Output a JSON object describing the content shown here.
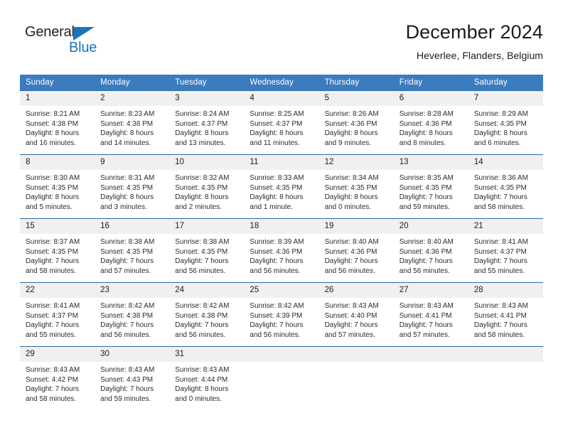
{
  "brand": {
    "name_dark": "General",
    "name_blue": "Blue",
    "accent_color": "#1a74bb",
    "triangle_icon": "triangle-icon"
  },
  "header": {
    "title": "December 2024",
    "subtitle": "Heverlee, Flanders, Belgium"
  },
  "theme": {
    "header_blue": "#3a7cbf",
    "row_rule": "#2e6da4",
    "daynum_band": "#f0f0f0"
  },
  "calendar": {
    "weekday_headers": [
      "Sunday",
      "Monday",
      "Tuesday",
      "Wednesday",
      "Thursday",
      "Friday",
      "Saturday"
    ],
    "weeks": [
      [
        {
          "day": "1",
          "sunrise": "Sunrise: 8:21 AM",
          "sunset": "Sunset: 4:38 PM",
          "daylight1": "Daylight: 8 hours",
          "daylight2": "and 16 minutes."
        },
        {
          "day": "2",
          "sunrise": "Sunrise: 8:23 AM",
          "sunset": "Sunset: 4:38 PM",
          "daylight1": "Daylight: 8 hours",
          "daylight2": "and 14 minutes."
        },
        {
          "day": "3",
          "sunrise": "Sunrise: 8:24 AM",
          "sunset": "Sunset: 4:37 PM",
          "daylight1": "Daylight: 8 hours",
          "daylight2": "and 13 minutes."
        },
        {
          "day": "4",
          "sunrise": "Sunrise: 8:25 AM",
          "sunset": "Sunset: 4:37 PM",
          "daylight1": "Daylight: 8 hours",
          "daylight2": "and 11 minutes."
        },
        {
          "day": "5",
          "sunrise": "Sunrise: 8:26 AM",
          "sunset": "Sunset: 4:36 PM",
          "daylight1": "Daylight: 8 hours",
          "daylight2": "and 9 minutes."
        },
        {
          "day": "6",
          "sunrise": "Sunrise: 8:28 AM",
          "sunset": "Sunset: 4:36 PM",
          "daylight1": "Daylight: 8 hours",
          "daylight2": "and 8 minutes."
        },
        {
          "day": "7",
          "sunrise": "Sunrise: 8:29 AM",
          "sunset": "Sunset: 4:35 PM",
          "daylight1": "Daylight: 8 hours",
          "daylight2": "and 6 minutes."
        }
      ],
      [
        {
          "day": "8",
          "sunrise": "Sunrise: 8:30 AM",
          "sunset": "Sunset: 4:35 PM",
          "daylight1": "Daylight: 8 hours",
          "daylight2": "and 5 minutes."
        },
        {
          "day": "9",
          "sunrise": "Sunrise: 8:31 AM",
          "sunset": "Sunset: 4:35 PM",
          "daylight1": "Daylight: 8 hours",
          "daylight2": "and 3 minutes."
        },
        {
          "day": "10",
          "sunrise": "Sunrise: 8:32 AM",
          "sunset": "Sunset: 4:35 PM",
          "daylight1": "Daylight: 8 hours",
          "daylight2": "and 2 minutes."
        },
        {
          "day": "11",
          "sunrise": "Sunrise: 8:33 AM",
          "sunset": "Sunset: 4:35 PM",
          "daylight1": "Daylight: 8 hours",
          "daylight2": "and 1 minute."
        },
        {
          "day": "12",
          "sunrise": "Sunrise: 8:34 AM",
          "sunset": "Sunset: 4:35 PM",
          "daylight1": "Daylight: 8 hours",
          "daylight2": "and 0 minutes."
        },
        {
          "day": "13",
          "sunrise": "Sunrise: 8:35 AM",
          "sunset": "Sunset: 4:35 PM",
          "daylight1": "Daylight: 7 hours",
          "daylight2": "and 59 minutes."
        },
        {
          "day": "14",
          "sunrise": "Sunrise: 8:36 AM",
          "sunset": "Sunset: 4:35 PM",
          "daylight1": "Daylight: 7 hours",
          "daylight2": "and 58 minutes."
        }
      ],
      [
        {
          "day": "15",
          "sunrise": "Sunrise: 8:37 AM",
          "sunset": "Sunset: 4:35 PM",
          "daylight1": "Daylight: 7 hours",
          "daylight2": "and 58 minutes."
        },
        {
          "day": "16",
          "sunrise": "Sunrise: 8:38 AM",
          "sunset": "Sunset: 4:35 PM",
          "daylight1": "Daylight: 7 hours",
          "daylight2": "and 57 minutes."
        },
        {
          "day": "17",
          "sunrise": "Sunrise: 8:38 AM",
          "sunset": "Sunset: 4:35 PM",
          "daylight1": "Daylight: 7 hours",
          "daylight2": "and 56 minutes."
        },
        {
          "day": "18",
          "sunrise": "Sunrise: 8:39 AM",
          "sunset": "Sunset: 4:36 PM",
          "daylight1": "Daylight: 7 hours",
          "daylight2": "and 56 minutes."
        },
        {
          "day": "19",
          "sunrise": "Sunrise: 8:40 AM",
          "sunset": "Sunset: 4:36 PM",
          "daylight1": "Daylight: 7 hours",
          "daylight2": "and 56 minutes."
        },
        {
          "day": "20",
          "sunrise": "Sunrise: 8:40 AM",
          "sunset": "Sunset: 4:36 PM",
          "daylight1": "Daylight: 7 hours",
          "daylight2": "and 56 minutes."
        },
        {
          "day": "21",
          "sunrise": "Sunrise: 8:41 AM",
          "sunset": "Sunset: 4:37 PM",
          "daylight1": "Daylight: 7 hours",
          "daylight2": "and 55 minutes."
        }
      ],
      [
        {
          "day": "22",
          "sunrise": "Sunrise: 8:41 AM",
          "sunset": "Sunset: 4:37 PM",
          "daylight1": "Daylight: 7 hours",
          "daylight2": "and 55 minutes."
        },
        {
          "day": "23",
          "sunrise": "Sunrise: 8:42 AM",
          "sunset": "Sunset: 4:38 PM",
          "daylight1": "Daylight: 7 hours",
          "daylight2": "and 56 minutes."
        },
        {
          "day": "24",
          "sunrise": "Sunrise: 8:42 AM",
          "sunset": "Sunset: 4:38 PM",
          "daylight1": "Daylight: 7 hours",
          "daylight2": "and 56 minutes."
        },
        {
          "day": "25",
          "sunrise": "Sunrise: 8:42 AM",
          "sunset": "Sunset: 4:39 PM",
          "daylight1": "Daylight: 7 hours",
          "daylight2": "and 56 minutes."
        },
        {
          "day": "26",
          "sunrise": "Sunrise: 8:43 AM",
          "sunset": "Sunset: 4:40 PM",
          "daylight1": "Daylight: 7 hours",
          "daylight2": "and 57 minutes."
        },
        {
          "day": "27",
          "sunrise": "Sunrise: 8:43 AM",
          "sunset": "Sunset: 4:41 PM",
          "daylight1": "Daylight: 7 hours",
          "daylight2": "and 57 minutes."
        },
        {
          "day": "28",
          "sunrise": "Sunrise: 8:43 AM",
          "sunset": "Sunset: 4:41 PM",
          "daylight1": "Daylight: 7 hours",
          "daylight2": "and 58 minutes."
        }
      ],
      [
        {
          "day": "29",
          "sunrise": "Sunrise: 8:43 AM",
          "sunset": "Sunset: 4:42 PM",
          "daylight1": "Daylight: 7 hours",
          "daylight2": "and 58 minutes."
        },
        {
          "day": "30",
          "sunrise": "Sunrise: 8:43 AM",
          "sunset": "Sunset: 4:43 PM",
          "daylight1": "Daylight: 7 hours",
          "daylight2": "and 59 minutes."
        },
        {
          "day": "31",
          "sunrise": "Sunrise: 8:43 AM",
          "sunset": "Sunset: 4:44 PM",
          "daylight1": "Daylight: 8 hours",
          "daylight2": "and 0 minutes."
        },
        {
          "day": "",
          "sunrise": "",
          "sunset": "",
          "daylight1": "",
          "daylight2": ""
        },
        {
          "day": "",
          "sunrise": "",
          "sunset": "",
          "daylight1": "",
          "daylight2": ""
        },
        {
          "day": "",
          "sunrise": "",
          "sunset": "",
          "daylight1": "",
          "daylight2": ""
        },
        {
          "day": "",
          "sunrise": "",
          "sunset": "",
          "daylight1": "",
          "daylight2": ""
        }
      ]
    ]
  }
}
